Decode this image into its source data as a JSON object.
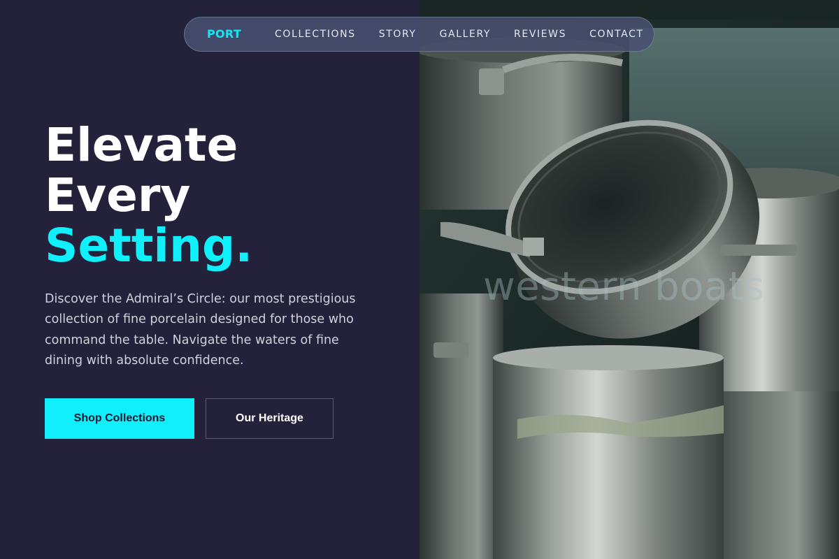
{
  "nav": {
    "logo": "PORT",
    "items": [
      "COLLECTIONS",
      "STORY",
      "GALLERY",
      "REVIEWS",
      "CONTACT"
    ]
  },
  "hero": {
    "line1": "Elevate",
    "line2": "Every",
    "line3": "Setting.",
    "description": "Discover the Admiral’s Circle: our most prestigious collection of fine porcelain designed for those who command the table. Navigate the waters of fine dining with absolute confidence.",
    "primary_button": "Shop Collections",
    "secondary_button": "Our Heritage"
  },
  "image": {
    "watermark": "western boats"
  },
  "colors": {
    "background": "#23223a",
    "accent": "#0ff0fc",
    "text": "#ffffff",
    "muted_text": "#d0d2de"
  }
}
